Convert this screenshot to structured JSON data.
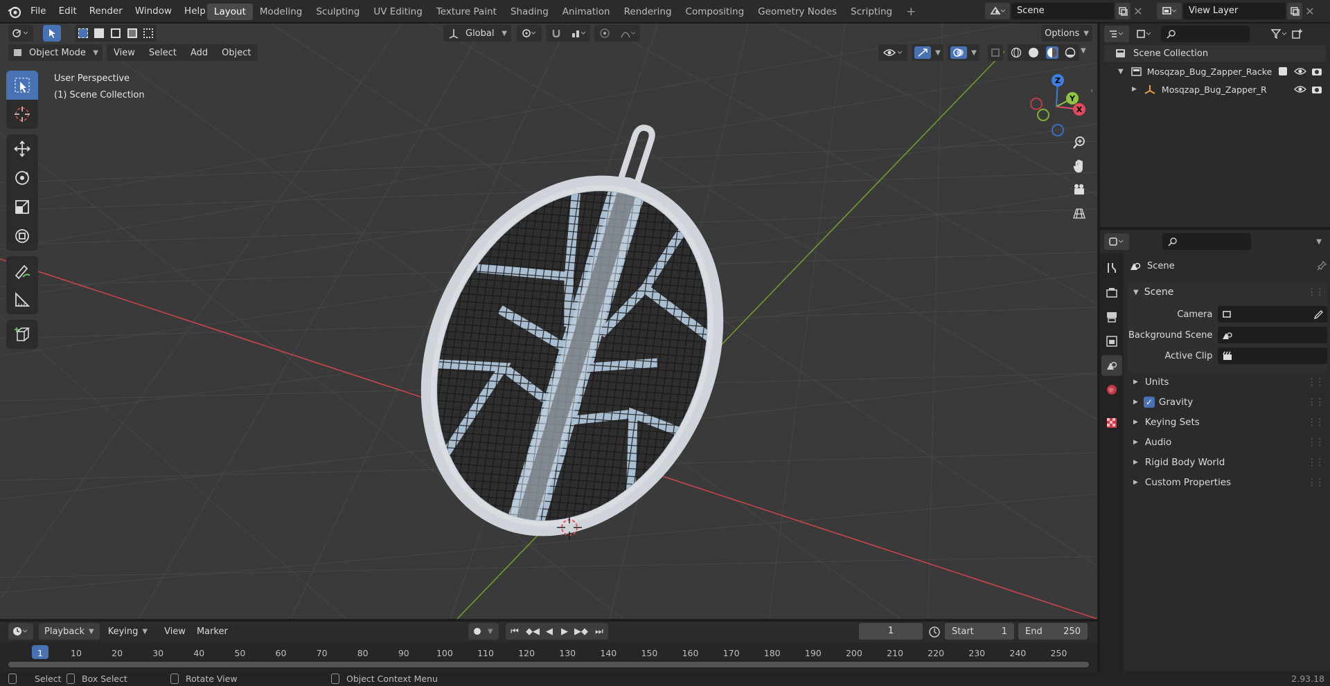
{
  "menus": [
    "File",
    "Edit",
    "Render",
    "Window",
    "Help"
  ],
  "workspaces": [
    "Layout",
    "Modeling",
    "Sculpting",
    "UV Editing",
    "Texture Paint",
    "Shading",
    "Animation",
    "Rendering",
    "Compositing",
    "Geometry Nodes",
    "Scripting"
  ],
  "active_workspace": "Layout",
  "scene_field": "Scene",
  "view_layer_field": "View Layer",
  "viewport": {
    "transform_orientation": "Global",
    "options_label": "Options",
    "mode": "Object Mode",
    "menus": [
      "View",
      "Select",
      "Add",
      "Object"
    ],
    "overlay_line1": "User Perspective",
    "overlay_line2": "(1) Scene Collection",
    "axes": {
      "z": "Z",
      "y": "Y",
      "x": "X"
    }
  },
  "outliner": {
    "root": "Scene Collection",
    "collection": "Mosqzap_Bug_Zapper_Racke",
    "object": "Mosqzap_Bug_Zapper_R"
  },
  "properties": {
    "context_title": "Scene",
    "panel_title": "Scene",
    "camera_label": "Camera",
    "background_scene_label": "Background Scene",
    "active_clip_label": "Active Clip",
    "sections": [
      "Units",
      "Gravity",
      "Keying Sets",
      "Audio",
      "Rigid Body World",
      "Custom Properties"
    ],
    "gravity_checked": true
  },
  "timeline": {
    "menus": [
      "Playback",
      "Keying",
      "View",
      "Marker"
    ],
    "current_frame": "1",
    "start_label": "Start",
    "start_value": "1",
    "end_label": "End",
    "end_value": "250",
    "ticks": [
      "1",
      "10",
      "20",
      "30",
      "40",
      "50",
      "60",
      "70",
      "80",
      "90",
      "100",
      "110",
      "120",
      "130",
      "140",
      "150",
      "160",
      "170",
      "180",
      "190",
      "200",
      "210",
      "220",
      "230",
      "240",
      "250"
    ]
  },
  "status": {
    "select": "Select",
    "box_select": "Box Select",
    "rotate_view": "Rotate View",
    "context_menu": "Object Context Menu",
    "version": "2.93.18"
  },
  "colors": {
    "accent": "#4772b3",
    "x_axis": "#e04a5a",
    "y_axis": "#8cc63f",
    "z_axis": "#3d7fe0"
  }
}
